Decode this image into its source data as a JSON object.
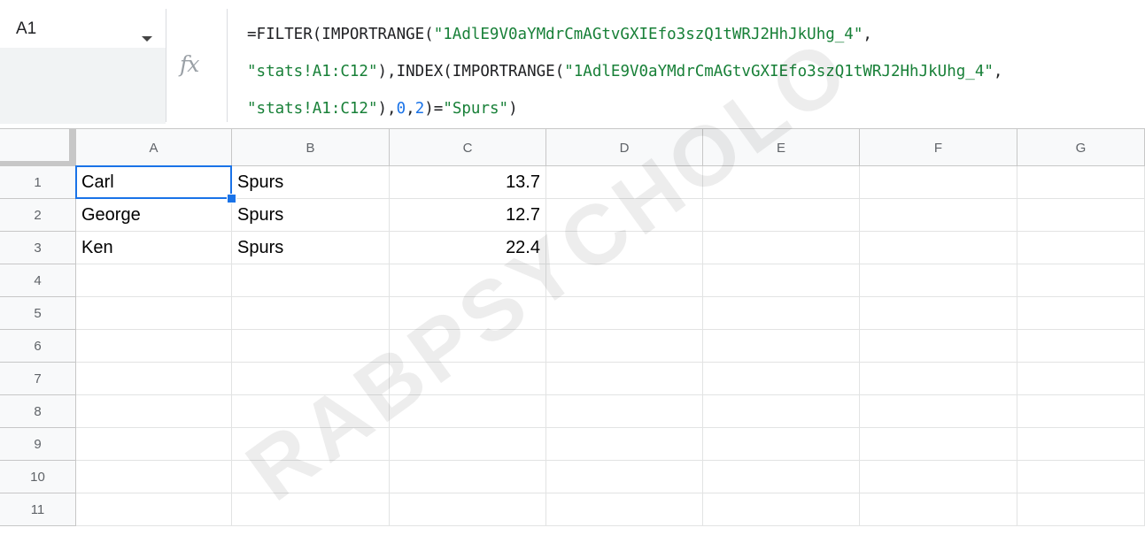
{
  "name_box": {
    "value": "A1"
  },
  "formula_bar": {
    "fx_label": "fx",
    "lines": [
      [
        {
          "t": "=FILTER(IMPORTRANGE(",
          "c": "plain"
        },
        {
          "t": "\"1AdlE9V0aYMdrCmAGtvGXIEfo3szQ1tWRJ2HhJkUhg_4\"",
          "c": "str"
        },
        {
          "t": ",",
          "c": "plain"
        }
      ],
      [
        {
          "t": "\"stats!A1:C12\"",
          "c": "str"
        },
        {
          "t": "),INDEX(IMPORTRANGE(",
          "c": "plain"
        },
        {
          "t": "\"1AdlE9V0aYMdrCmAGtvGXIEfo3szQ1tWRJ2HhJkUhg_4\"",
          "c": "str"
        },
        {
          "t": ",",
          "c": "plain"
        }
      ],
      [
        {
          "t": "\"stats!A1:C12\"",
          "c": "str"
        },
        {
          "t": "),",
          "c": "plain"
        },
        {
          "t": "0",
          "c": "num"
        },
        {
          "t": ",",
          "c": "plain"
        },
        {
          "t": "2",
          "c": "num"
        },
        {
          "t": ")=",
          "c": "plain"
        },
        {
          "t": "\"Spurs\"",
          "c": "str"
        },
        {
          "t": ")",
          "c": "plain"
        }
      ]
    ]
  },
  "columns": [
    "A",
    "B",
    "C",
    "D",
    "E",
    "F",
    "G"
  ],
  "rows": [
    "1",
    "2",
    "3",
    "4",
    "5",
    "6",
    "7",
    "8",
    "9",
    "10",
    "11"
  ],
  "cells": [
    [
      "Carl",
      "Spurs",
      "13.7"
    ],
    [
      "George",
      "Spurs",
      "12.7"
    ],
    [
      "Ken",
      "Spurs",
      "22.4"
    ]
  ],
  "selected_cell": "A1",
  "watermark": "RABPSYCHOLO",
  "colors": {
    "selection": "#1a73e8",
    "formula_string": "#188038",
    "formula_number": "#1a73e8",
    "header_bg": "#f8f9fa"
  }
}
